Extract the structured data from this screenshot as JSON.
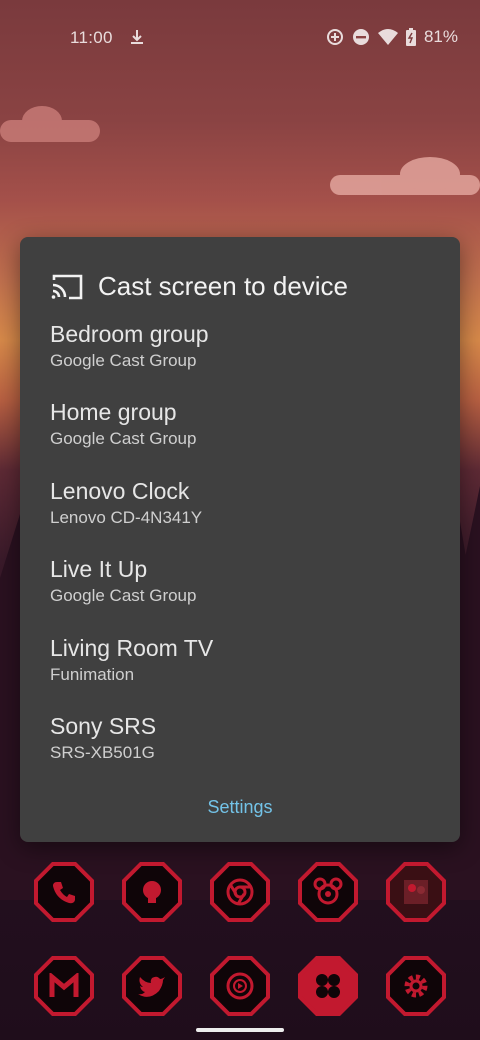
{
  "status_bar": {
    "time": "11:00",
    "battery": "81%",
    "icons": [
      "download-icon",
      "data-saver-icon",
      "do-not-disturb-icon",
      "wifi-icon",
      "battery-icon"
    ]
  },
  "dialog": {
    "title": "Cast screen to device",
    "icon": "cast-icon",
    "devices": [
      {
        "name": "Bedroom group",
        "subtitle": "Google Cast Group"
      },
      {
        "name": "Home group",
        "subtitle": "Google Cast Group"
      },
      {
        "name": "Lenovo Clock",
        "subtitle": "Lenovo CD-4N341Y"
      },
      {
        "name": "Live It Up",
        "subtitle": "Google Cast Group"
      },
      {
        "name": "Living Room TV",
        "subtitle": "Funimation"
      },
      {
        "name": "Sony SRS",
        "subtitle": "SRS-XB501G"
      }
    ],
    "settings_label": "Settings"
  },
  "home_apps": {
    "row1": [
      "phone-icon",
      "messages-icon",
      "chrome-icon",
      "disney-icon",
      "photo-app-icon"
    ],
    "row2": [
      "gmail-icon",
      "twitter-icon",
      "youtube-music-icon",
      "folder-icon",
      "settings-gear-icon"
    ]
  },
  "colors": {
    "dialog_bg": "#404040",
    "accent": "#73c3e8",
    "icon_red": "#c2192f"
  }
}
